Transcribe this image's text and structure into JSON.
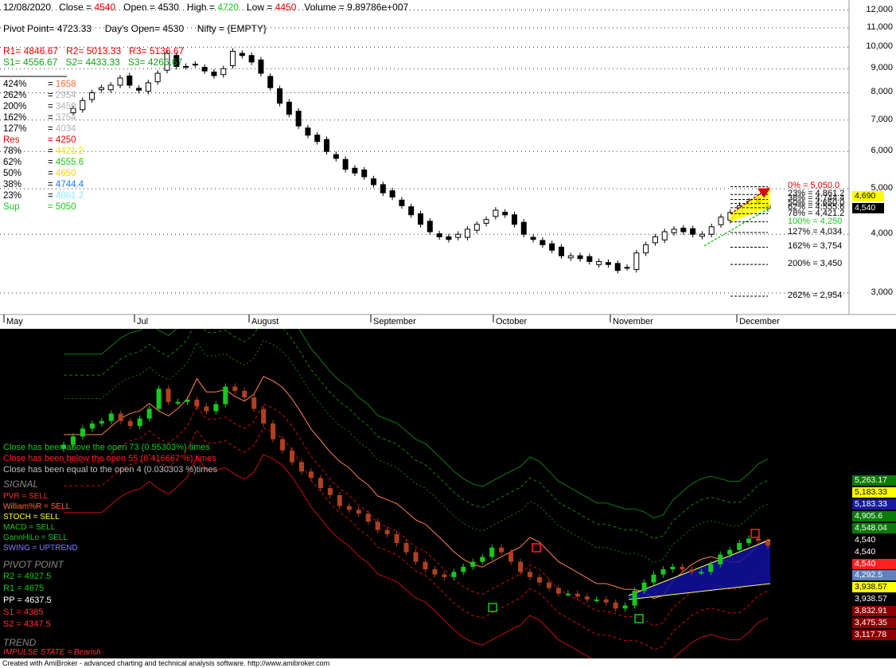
{
  "header": {
    "date": "12/08/2020",
    "close_label": "Close = ",
    "close": "4540",
    "open_label": "Open = ",
    "open": "4530",
    "high_label": "High = ",
    "high": "4720",
    "low_label": "Low = ",
    "low": "4450",
    "volume": "Volume = 9.89786e+007",
    "pivot": "Pivot Point= 4723.33",
    "days_open": "Day's Open= 4530",
    "nifty": "Nifty = {EMPTY}",
    "r1": "R1= 4846.67",
    "r2": "R2= 5013.33",
    "r3": "R3= 5136.67",
    "s1": "S1= 4556.67",
    "s2": "S2= 4433.33",
    "s3": "S3= 4266.67"
  },
  "fib_levels_left": [
    {
      "pct": "424%",
      "val": "1658",
      "color": "#ff6a3a"
    },
    {
      "pct": "262%",
      "val": "2954",
      "color": "#b4b4b4"
    },
    {
      "pct": "200%",
      "val": "3450",
      "color": "#b4b4b4"
    },
    {
      "pct": "162%",
      "val": "3754",
      "color": "#b4b4b4"
    },
    {
      "pct": "127%",
      "val": "4034",
      "color": "#b4b4b4"
    },
    {
      "pct": "Res",
      "val": "4250",
      "color": "#e00000"
    },
    {
      "pct": "78%",
      "val": "4421.2",
      "color": "#e6e600"
    },
    {
      "pct": "62%",
      "val": "4555.6",
      "color": "#19c81e"
    },
    {
      "pct": "50%",
      "val": "4650",
      "color": "#ffd700"
    },
    {
      "pct": "38%",
      "val": "4744.4",
      "color": "#1e78ff"
    },
    {
      "pct": "23%",
      "val": "4861.2",
      "color": "#8fe8ff"
    },
    {
      "pct": "Sup",
      "val": "5050",
      "color": "#19c81e"
    }
  ],
  "fib_levels_right": [
    {
      "text": "0% = 5,050.0",
      "color": "#e00000"
    },
    {
      "text": "23% = 4,861.2",
      "color": "#000"
    },
    {
      "text": "38% = 4,744.4",
      "color": "#000"
    },
    {
      "text": "50% = 4,650.0",
      "color": "#000"
    },
    {
      "text": "62% = 4,555.6",
      "color": "#000"
    },
    {
      "text": "78% = 4,421.2",
      "color": "#000"
    },
    {
      "text": "100% = 4,250",
      "color": "#19c81e"
    },
    {
      "text": "127% = 4,034",
      "color": "#000"
    },
    {
      "text": "162% = 3,754",
      "color": "#000"
    },
    {
      "text": "200% = 3,450",
      "color": "#000"
    },
    {
      "text": "262% = 2,954",
      "color": "#000"
    }
  ],
  "price_axis": [
    "12,000",
    "11,000",
    "10,000",
    "9,000",
    "8,000",
    "7,000",
    "6,000",
    "5,000",
    "4,000",
    "3,000"
  ],
  "price_tags": [
    {
      "text": "4,690",
      "bg": "#ffff00",
      "color": "#000"
    },
    {
      "text": "4,540",
      "bg": "#000",
      "color": "#fff"
    }
  ],
  "months": [
    "May",
    "Jul",
    "August",
    "September",
    "October",
    "November",
    "December"
  ],
  "stats": {
    "above": "Close has been above the open 73 (0.55303%) times",
    "below": "Close has been below the open 55 (0.416667 %) times",
    "equal": "Close has been equal to the open 4 (0.030303 %)times"
  },
  "signal": {
    "title": "SIGNAL",
    "items": [
      {
        "text": "PVR = SELL",
        "color": "#ff3030"
      },
      {
        "text": "William%R = SELL",
        "color": "#ff6a3a"
      },
      {
        "text": "STOCH = SELL",
        "color": "#ffff40"
      },
      {
        "text": "MACD = SELL",
        "color": "#19c81e"
      },
      {
        "text": "GannHiLo = SELL",
        "color": "#19c81e"
      },
      {
        "text": "SWING = UPTREND",
        "color": "#8080ff"
      }
    ]
  },
  "pivot_block": {
    "title": "PIVOT POINT",
    "items": [
      {
        "text": "R2 = 4927.5",
        "color": "#19c81e"
      },
      {
        "text": "R1 = 4675",
        "color": "#19c81e"
      },
      {
        "text": "PP = 4637.5",
        "color": "#ffffff"
      },
      {
        "text": "S1 = 4385",
        "color": "#ff3030"
      },
      {
        "text": "S2 = 4347.5",
        "color": "#ff3030"
      }
    ]
  },
  "trend": {
    "title": "TREND",
    "impulse": "IMPULSE STATE = Bearish"
  },
  "lower_tags": [
    {
      "text": "5,263.17",
      "bg": "#0a7a0a",
      "color": "#fff"
    },
    {
      "text": "5,183.33",
      "bg": "#ffff00",
      "color": "#000"
    },
    {
      "text": "5,183.33",
      "bg": "#1a1aa0",
      "color": "#fff"
    },
    {
      "text": "4,905.6",
      "bg": "#0a7a0a",
      "color": "#fff"
    },
    {
      "text": "4,548.04",
      "bg": "#0a7a0a",
      "color": "#fff"
    },
    {
      "text": "4,540",
      "bg": "#000",
      "color": "#fff"
    },
    {
      "text": "4,540",
      "bg": "#000",
      "color": "#fff"
    },
    {
      "text": "4,540",
      "bg": "#ff2020",
      "color": "#fff"
    },
    {
      "text": "4,292.5",
      "bg": "#6080c0",
      "color": "#fff"
    },
    {
      "text": "3,938.57",
      "bg": "#ffff00",
      "color": "#000"
    },
    {
      "text": "3,938.57",
      "bg": "#000",
      "color": "#fff"
    },
    {
      "text": "3,832.91",
      "bg": "#8b0000",
      "color": "#fff"
    },
    {
      "text": "3,475.35",
      "bg": "#8b0000",
      "color": "#fff"
    },
    {
      "text": "3,117.78",
      "bg": "#8b0000",
      "color": "#fff"
    }
  ],
  "footer": "Created with AmiBroker - advanced charting and technical analysis software. http://www.amibroker.com",
  "chart_data": {
    "type": "candlestick",
    "scale": "log",
    "ylim": [
      2700,
      12600
    ],
    "x_months": [
      "May",
      "Jul",
      "August",
      "September",
      "October",
      "November",
      "December"
    ],
    "close_series": [
      7400,
      7700,
      8000,
      8200,
      8300,
      8600,
      8300,
      8100,
      8400,
      8800,
      9700,
      9100,
      9100,
      9200,
      8900,
      8700,
      9000,
      9800,
      9600,
      9300,
      8800,
      8200,
      7600,
      7200,
      6800,
      6500,
      6300,
      6000,
      5800,
      5500,
      5400,
      5300,
      5100,
      4900,
      4800,
      4600,
      4400,
      4200,
      4050,
      3950,
      3900,
      4000,
      4100,
      4200,
      4300,
      4500,
      4400,
      4200,
      4000,
      3900,
      3800,
      3700,
      3600,
      3600,
      3550,
      3500,
      3500,
      3450,
      3350,
      3400,
      3650,
      3800,
      3950,
      4050,
      4100,
      4050,
      4000,
      4000,
      4150,
      4350,
      4450,
      4600,
      4700,
      4650,
      4540
    ],
    "fib_channel": {
      "top_left": 4420,
      "top_right": 5050,
      "bottom_left": 4250,
      "bottom_right": 4555
    }
  }
}
